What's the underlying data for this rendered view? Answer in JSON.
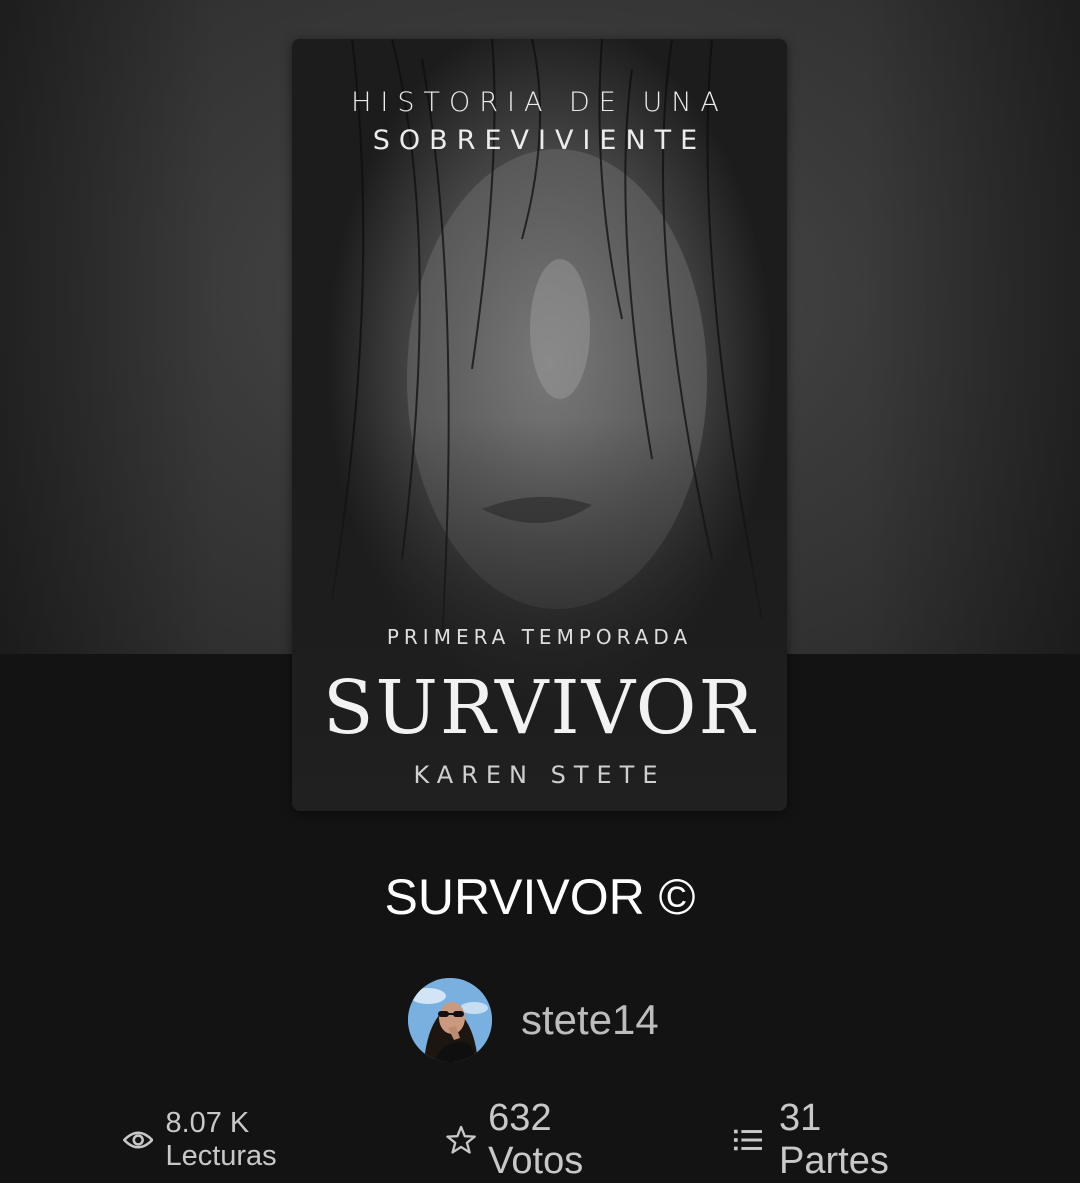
{
  "cover": {
    "tagline_line1": "HISTORIA DE UNA",
    "tagline_line2": "SOBREVIVIENTE",
    "season": "PRIMERA TEMPORADA",
    "title": "SURVIVOR",
    "author": "KAREN STETE"
  },
  "story": {
    "title": "SURVIVOR ©"
  },
  "author": {
    "username": "stete14",
    "avatar_icon": "user-avatar"
  },
  "stats": {
    "reads": {
      "icon": "eye-icon",
      "label": "8.07 K Lecturas"
    },
    "votes": {
      "icon": "star-icon",
      "label": "632 Votos"
    },
    "parts": {
      "icon": "list-icon",
      "label": "31 Partes"
    }
  },
  "colors": {
    "background": "#131313",
    "hero": "#3a3a3a",
    "title_text": "#ffffff",
    "secondary_text": "#c8c8c8"
  }
}
